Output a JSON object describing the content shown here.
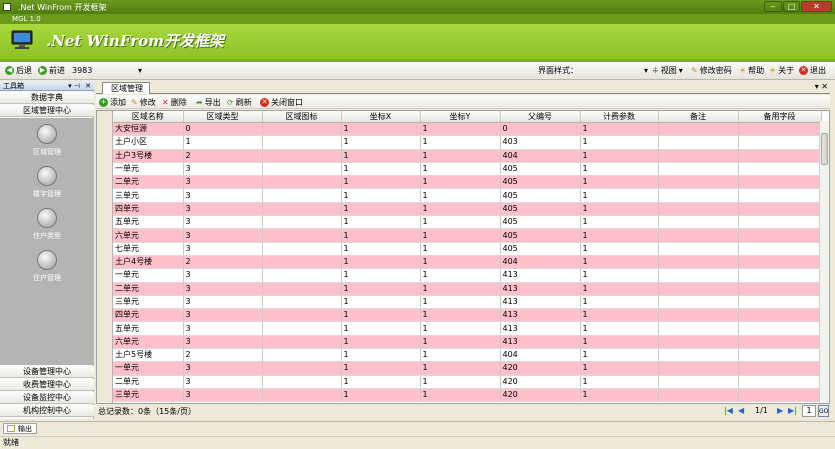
{
  "window": {
    "title": ".Net WinFrom 开发框架",
    "min": "‒",
    "max": "□",
    "close": "✕"
  },
  "menu": {
    "version": "MGL 1.0"
  },
  "banner": {
    "title": ".Net WinFrom开发框架"
  },
  "nav": {
    "back": "后退",
    "forward": "前进",
    "address": "3983",
    "style_label": "界面样式：",
    "view": "视图",
    "change_password": "修改密码",
    "help": "帮助",
    "about": "关于",
    "exit": "退出"
  },
  "sidebar": {
    "header": "工具箱",
    "top_categories": [
      "数据字典",
      "区域管理中心"
    ],
    "items": [
      "区域管理",
      "楼宇管理",
      "住户类型",
      "住户管理"
    ],
    "bottom_categories": [
      "设备管理中心",
      "收费管理中心",
      "设备监控中心",
      "机构控制中心"
    ]
  },
  "tab": {
    "label": "区域管理"
  },
  "actions": {
    "add": "添加",
    "edit": "修改",
    "delete": "删除",
    "export": "导出",
    "refresh": "刷新",
    "close": "关闭窗口"
  },
  "grid": {
    "columns": [
      "区域名称",
      "区域类型",
      "区域图标",
      "坐标X",
      "坐标Y",
      "父编号",
      "计费参数",
      "备注",
      "备用字段"
    ],
    "rows": [
      [
        "大安恒源",
        "0",
        "",
        "1",
        "1",
        "0",
        "1",
        "",
        ""
      ],
      [
        "土户小区",
        "1",
        "",
        "1",
        "1",
        "403",
        "1",
        "",
        ""
      ],
      [
        "土户3号楼",
        "2",
        "",
        "1",
        "1",
        "404",
        "1",
        "",
        ""
      ],
      [
        "一单元",
        "3",
        "",
        "1",
        "1",
        "405",
        "1",
        "",
        ""
      ],
      [
        "二单元",
        "3",
        "",
        "1",
        "1",
        "405",
        "1",
        "",
        ""
      ],
      [
        "三单元",
        "3",
        "",
        "1",
        "1",
        "405",
        "1",
        "",
        ""
      ],
      [
        "四单元",
        "3",
        "",
        "1",
        "1",
        "405",
        "1",
        "",
        ""
      ],
      [
        "五单元",
        "3",
        "",
        "1",
        "1",
        "405",
        "1",
        "",
        ""
      ],
      [
        "六单元",
        "3",
        "",
        "1",
        "1",
        "405",
        "1",
        "",
        ""
      ],
      [
        "七单元",
        "3",
        "",
        "1",
        "1",
        "405",
        "1",
        "",
        ""
      ],
      [
        "土户4号楼",
        "2",
        "",
        "1",
        "1",
        "404",
        "1",
        "",
        ""
      ],
      [
        "一单元",
        "3",
        "",
        "1",
        "1",
        "413",
        "1",
        "",
        ""
      ],
      [
        "二单元",
        "3",
        "",
        "1",
        "1",
        "413",
        "1",
        "",
        ""
      ],
      [
        "三单元",
        "3",
        "",
        "1",
        "1",
        "413",
        "1",
        "",
        ""
      ],
      [
        "四单元",
        "3",
        "",
        "1",
        "1",
        "413",
        "1",
        "",
        ""
      ],
      [
        "五单元",
        "3",
        "",
        "1",
        "1",
        "413",
        "1",
        "",
        ""
      ],
      [
        "六单元",
        "3",
        "",
        "1",
        "1",
        "413",
        "1",
        "",
        ""
      ],
      [
        "土户5号楼",
        "2",
        "",
        "1",
        "1",
        "404",
        "1",
        "",
        ""
      ],
      [
        "一单元",
        "3",
        "",
        "1",
        "1",
        "420",
        "1",
        "",
        ""
      ],
      [
        "二单元",
        "3",
        "",
        "1",
        "1",
        "420",
        "1",
        "",
        ""
      ],
      [
        "三单元",
        "3",
        "",
        "1",
        "1",
        "420",
        "1",
        "",
        ""
      ]
    ]
  },
  "footer": {
    "summary": "总记录数：0条（15条/页）",
    "page_info": "1/1",
    "page_input": "1",
    "go": "GO"
  },
  "output_tab": "输出",
  "status": "就绪"
}
